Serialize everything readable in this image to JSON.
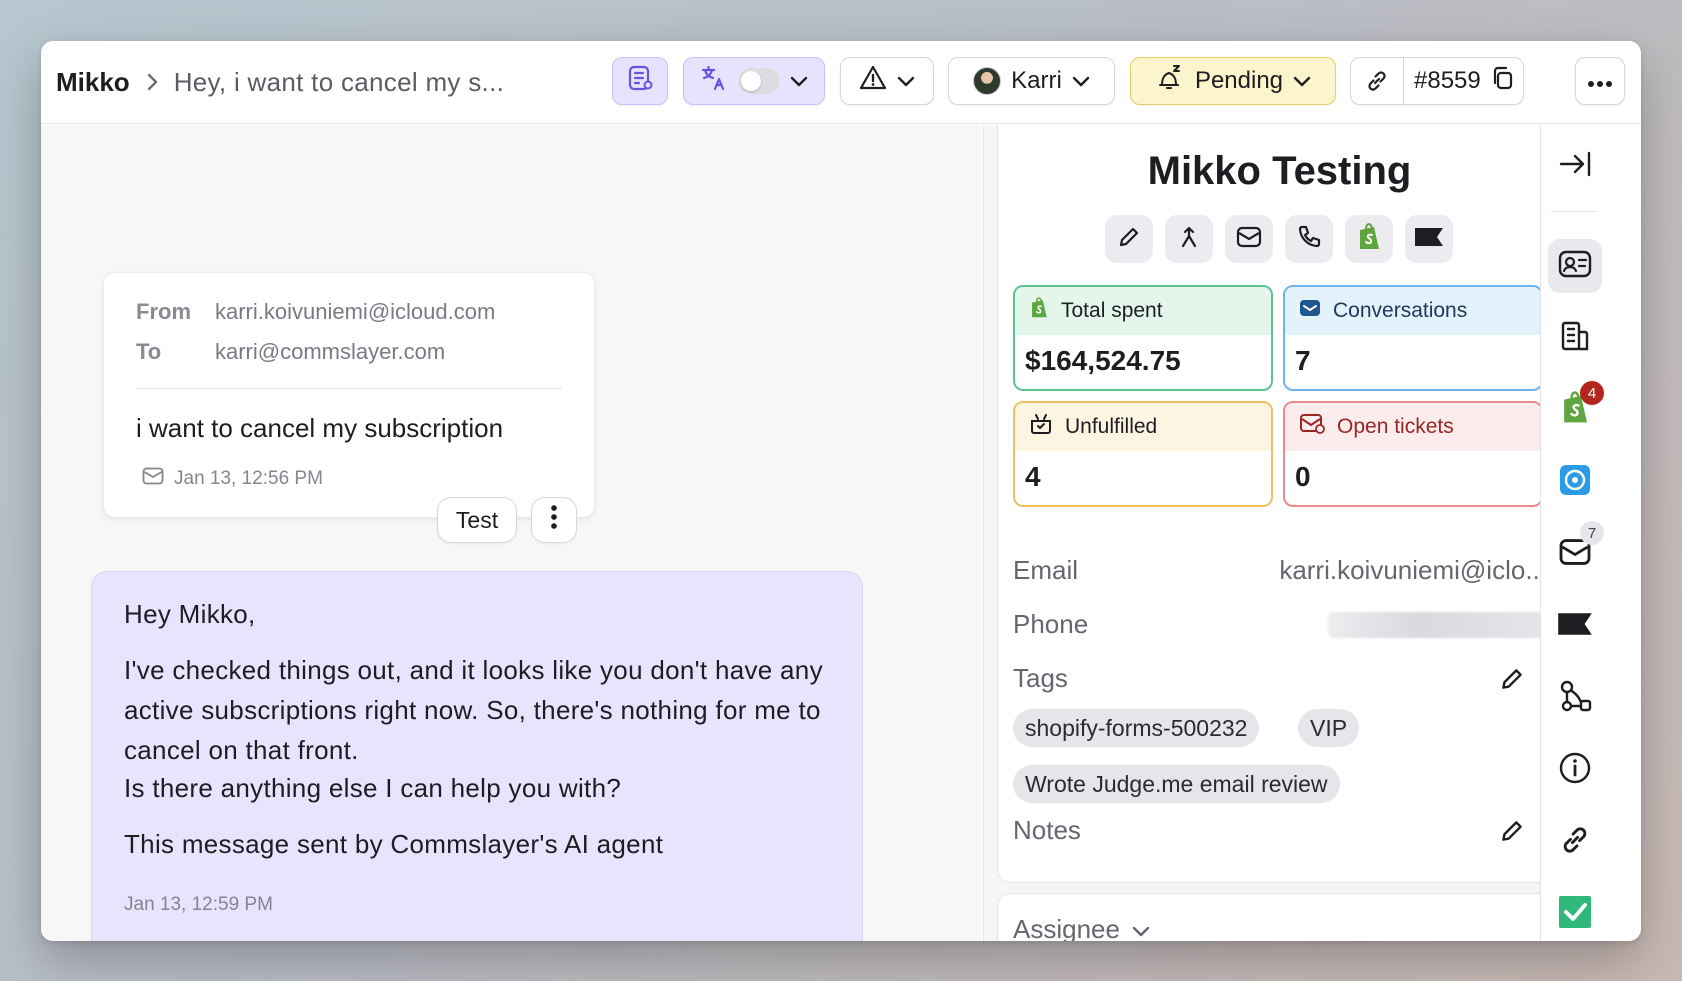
{
  "header": {
    "contact_name": "Mikko",
    "subject": "Hey, i want to cancel my s...",
    "assignee": "Karri",
    "status": "Pending",
    "ticket_id": "#8559"
  },
  "email": {
    "from_label": "From",
    "from": "karri.koivuniemi@icloud.com",
    "to_label": "To",
    "to": "karri@commslayer.com",
    "body": "i want to cancel my subscription",
    "time": "Jan 13, 12:56 PM",
    "test_label": "Test"
  },
  "ai_reply": {
    "greeting": "Hey Mikko,",
    "line1": "I've checked things out, and it looks like you don't have any active subscriptions right now. So, there's nothing for me to cancel on that front.",
    "line2": "Is there anything else I can help you with?",
    "line3": "This message sent by Commslayer's AI agent",
    "time": "Jan 13, 12:59 PM"
  },
  "profile": {
    "name": "Mikko Testing",
    "stats": {
      "total_spent_label": "Total spent",
      "total_spent": "$164,524.75",
      "conversations_label": "Conversations",
      "conversations": "7",
      "unfulfilled_label": "Unfulfilled",
      "unfulfilled": "4",
      "open_tickets_label": "Open tickets",
      "open_tickets": "0"
    },
    "email_label": "Email",
    "email": "karri.koivuniemi@iclo...",
    "phone_label": "Phone",
    "tags_label": "Tags",
    "tags": [
      "shopify-forms-500232",
      "VIP",
      "Wrote Judge.me email review"
    ],
    "notes_label": "Notes",
    "assignee_label": "Assignee"
  },
  "rail": {
    "shopify_badge": "4",
    "mail_badge": "7"
  },
  "colors": {
    "accent_purple": "#e7e3ff",
    "pending_yellow": "#fcf4cc",
    "ai_bubble": "#e9e4fd",
    "shopify_green": "#5fa540",
    "badge_red": "#b3261e"
  }
}
